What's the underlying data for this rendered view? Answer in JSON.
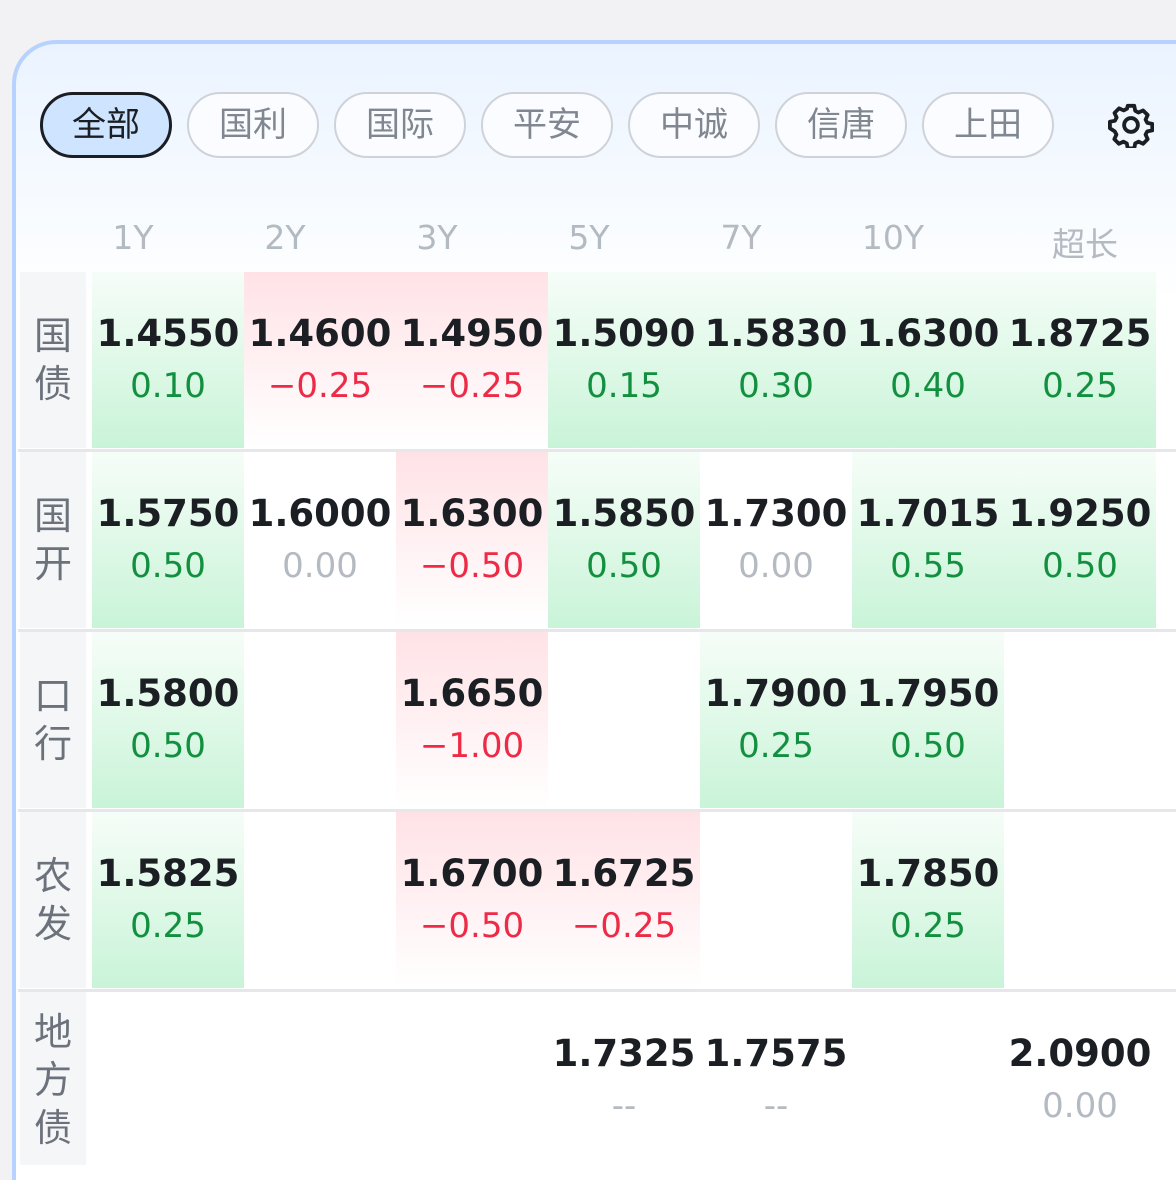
{
  "tabs": [
    "全部",
    "国利",
    "国际",
    "平安",
    "中诚",
    "信唐",
    "上田"
  ],
  "active_tab": 0,
  "columns": [
    "1Y",
    "2Y",
    "3Y",
    "5Y",
    "7Y",
    "10Y",
    "超长"
  ],
  "rows": [
    {
      "label": "国债",
      "cells": [
        {
          "value": "1.4550",
          "change": "0.10",
          "dir": "up"
        },
        {
          "value": "1.4600",
          "change": "−0.25",
          "dir": "down"
        },
        {
          "value": "1.4950",
          "change": "−0.25",
          "dir": "down"
        },
        {
          "value": "1.5090",
          "change": "0.15",
          "dir": "up"
        },
        {
          "value": "1.5830",
          "change": "0.30",
          "dir": "up"
        },
        {
          "value": "1.6300",
          "change": "0.40",
          "dir": "up"
        },
        {
          "value": "1.8725",
          "change": "0.25",
          "dir": "up"
        }
      ]
    },
    {
      "label": "国开",
      "cells": [
        {
          "value": "1.5750",
          "change": "0.50",
          "dir": "up"
        },
        {
          "value": "1.6000",
          "change": "0.00",
          "dir": "flat"
        },
        {
          "value": "1.6300",
          "change": "−0.50",
          "dir": "down"
        },
        {
          "value": "1.5850",
          "change": "0.50",
          "dir": "up"
        },
        {
          "value": "1.7300",
          "change": "0.00",
          "dir": "flat"
        },
        {
          "value": "1.7015",
          "change": "0.55",
          "dir": "up"
        },
        {
          "value": "1.9250",
          "change": "0.50",
          "dir": "up"
        }
      ]
    },
    {
      "label": "口行",
      "cells": [
        {
          "value": "1.5800",
          "change": "0.50",
          "dir": "up"
        },
        null,
        {
          "value": "1.6650",
          "change": "−1.00",
          "dir": "down"
        },
        null,
        {
          "value": "1.7900",
          "change": "0.25",
          "dir": "up"
        },
        {
          "value": "1.7950",
          "change": "0.50",
          "dir": "up"
        },
        null
      ]
    },
    {
      "label": "农发",
      "cells": [
        {
          "value": "1.5825",
          "change": "0.25",
          "dir": "up"
        },
        null,
        {
          "value": "1.6700",
          "change": "−0.50",
          "dir": "down"
        },
        {
          "value": "1.6725",
          "change": "−0.25",
          "dir": "down"
        },
        null,
        {
          "value": "1.7850",
          "change": "0.25",
          "dir": "up"
        },
        null
      ]
    },
    {
      "label": "地方债",
      "cells": [
        null,
        null,
        null,
        {
          "value": "1.7325",
          "change": "--",
          "dir": "flat"
        },
        {
          "value": "1.7575",
          "change": "--",
          "dir": "flat"
        },
        null,
        {
          "value": "2.0900",
          "change": "0.00",
          "dir": "flat"
        }
      ]
    }
  ],
  "icons": {
    "settings": "gear-icon"
  },
  "colors": {
    "up": "#12903f",
    "down": "#ee2a46",
    "flat": "#b4bac2",
    "active_tab_bg": "#cfe4ff"
  }
}
